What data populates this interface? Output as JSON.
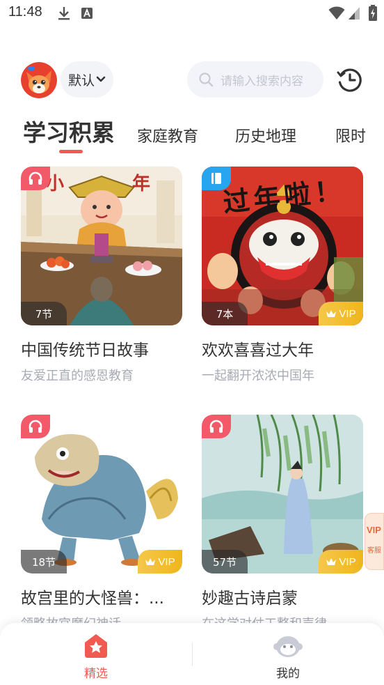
{
  "status_bar": {
    "time": "11:48"
  },
  "header": {
    "mode_label": "默认",
    "search_placeholder": "请输入搜索内容"
  },
  "tabs": [
    {
      "label": "学习积累",
      "active": true
    },
    {
      "label": "家庭教育",
      "active": false
    },
    {
      "label": "历史地理",
      "active": false
    },
    {
      "label": "限时",
      "active": false
    }
  ],
  "cards": [
    {
      "title": "中国传统节日故事",
      "subtitle": "友爱正直的感恩教育",
      "count": "7节",
      "type": "audio",
      "vip": false
    },
    {
      "title": "欢欢喜喜过大年",
      "subtitle": "一起翻开浓浓中国年",
      "count": "7本",
      "type": "book",
      "vip": true,
      "vip_label": "VIP"
    },
    {
      "title": "故宫里的大怪兽：...",
      "subtitle": "领略故宫魔幻神话",
      "count": "18节",
      "type": "audio",
      "vip": true,
      "vip_label": "VIP"
    },
    {
      "title": "妙趣古诗启蒙",
      "subtitle": "在这学对仗工整和声律",
      "count": "57节",
      "type": "audio",
      "vip": true,
      "vip_label": "VIP"
    }
  ],
  "cover_text": {
    "card1_left": "小",
    "card1_right": "年",
    "card2_banner": "过年啦！"
  },
  "float_promo": {
    "line1": "VIP",
    "line2": "客服"
  },
  "bottom_nav": [
    {
      "label": "精选",
      "active": true
    },
    {
      "label": "我的",
      "active": false
    }
  ],
  "colors": {
    "accent": "#f05a50",
    "vip_gold": "#f0b51c",
    "audio_badge": "#f25a6a",
    "book_badge": "#27a6ef"
  }
}
